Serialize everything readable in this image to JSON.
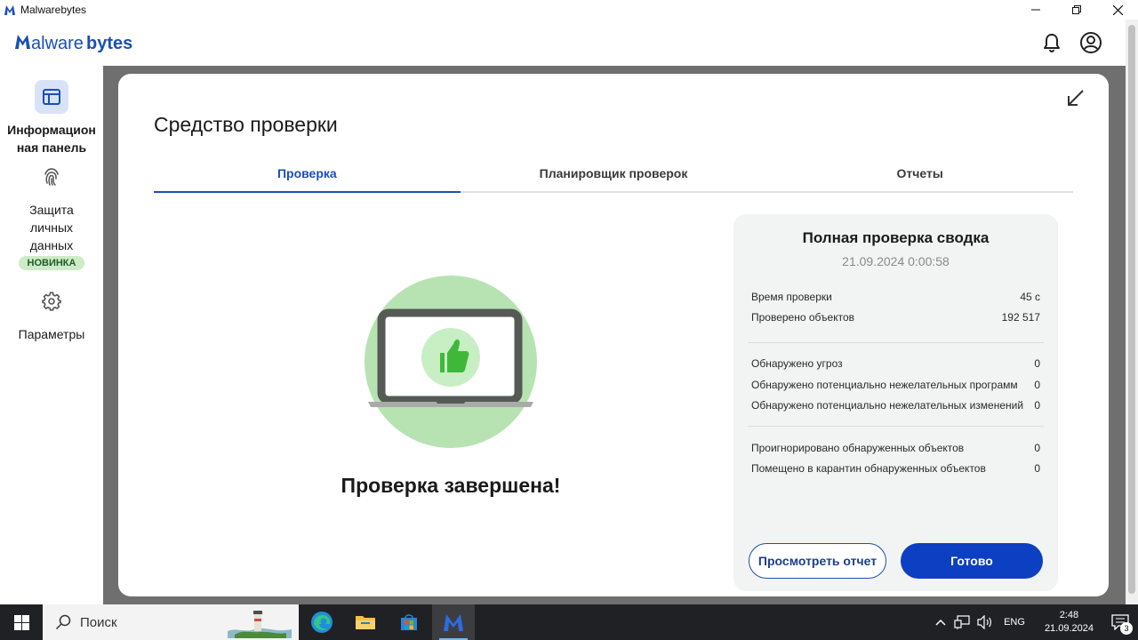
{
  "window": {
    "title": "Malwarebytes"
  },
  "header": {
    "logo_text": "Malwarebytes"
  },
  "sidebar": {
    "items": [
      {
        "label_line1": "Информацион",
        "label_line2": "ная панель",
        "icon": "dashboard-icon"
      },
      {
        "label_line1": "Защита",
        "label_line2": "личных",
        "label_line3": "данных",
        "badge": "НОВИНКА",
        "icon": "fingerprint-icon"
      },
      {
        "label_line1": "Параметры",
        "icon": "gear-icon"
      }
    ]
  },
  "modal": {
    "title": "Средство проверки",
    "tabs": [
      {
        "label": "Проверка",
        "active": true
      },
      {
        "label": "Планировщик проверок",
        "active": false
      },
      {
        "label": "Отчеты",
        "active": false
      }
    ],
    "status_text": "Проверка завершена!",
    "summary": {
      "title": "Полная проверка сводка",
      "date": "21.09.2024 0:00:58",
      "rows": [
        {
          "label": "Время проверки",
          "value": "45 с"
        },
        {
          "label": "Проверено объектов",
          "value": "192 517"
        },
        {
          "label": "Обнаружено угроз",
          "value": "0"
        },
        {
          "label": "Обнаружено потенциально нежелательных программ",
          "value": "0"
        },
        {
          "label": "Обнаружено потенциально нежелательных изменений",
          "value": "0"
        },
        {
          "label": "Проигнорировано обнаруженных объектов",
          "value": "0"
        },
        {
          "label": "Помещено в карантин обнаруженных объектов",
          "value": "0"
        }
      ],
      "view_report_label": "Просмотреть отчет",
      "done_label": "Готово"
    }
  },
  "taskbar": {
    "search_placeholder": "Поиск",
    "language": "ENG",
    "time": "2:48",
    "date": "21.09.2024",
    "notification_count": "3"
  },
  "colors": {
    "accent": "#0d3fc2",
    "brand": "#1a4fb5",
    "success": "#3fb83a"
  }
}
